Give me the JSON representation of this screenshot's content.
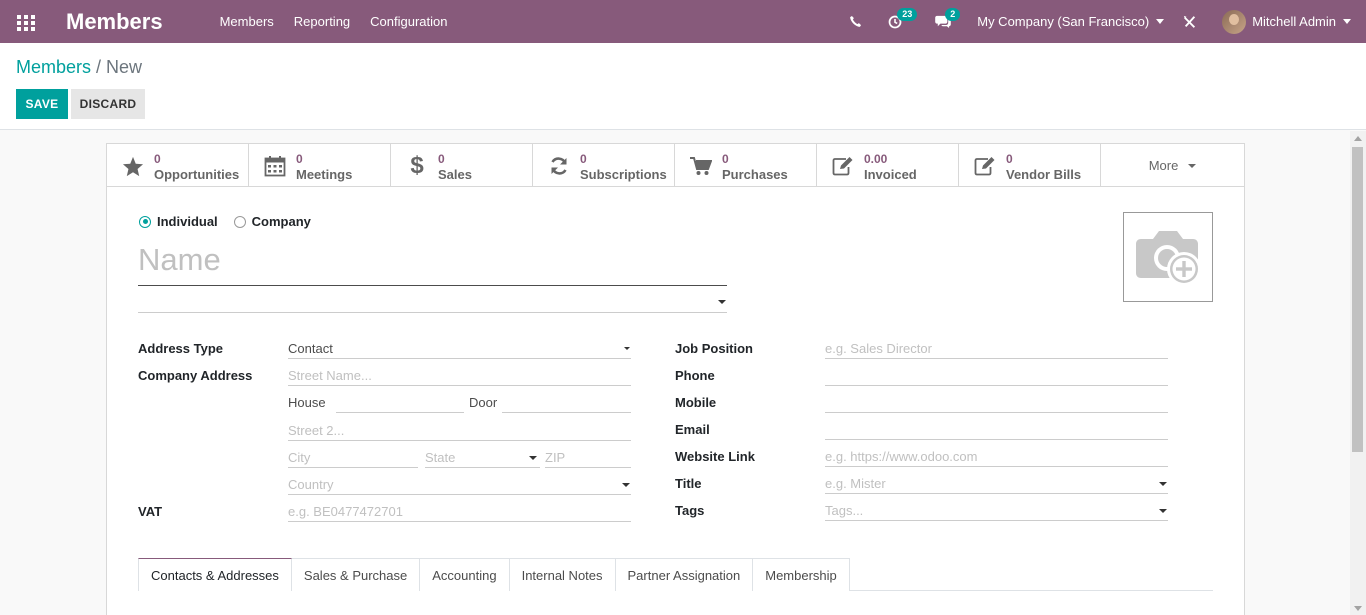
{
  "navbar": {
    "brand": "Members",
    "menu": [
      "Members",
      "Reporting",
      "Configuration"
    ],
    "activity_count": "23",
    "message_count": "2",
    "company": "My Company (San Francisco)",
    "user": "Mitchell Admin"
  },
  "breadcrumb": {
    "parent": "Members",
    "separator": "/",
    "current": "New"
  },
  "buttons": {
    "save": "SAVE",
    "discard": "DISCARD"
  },
  "stat_buttons": [
    {
      "value": "0",
      "label": "Opportunities",
      "icon": "star-icon"
    },
    {
      "value": "0",
      "label": "Meetings",
      "icon": "calendar-icon"
    },
    {
      "value": "0",
      "label": "Sales",
      "icon": "dollar-icon"
    },
    {
      "value": "0",
      "label": "Subscriptions",
      "icon": "refresh-icon"
    },
    {
      "value": "0",
      "label": "Purchases",
      "icon": "cart-icon"
    },
    {
      "value": "0.00",
      "label": "Invoiced",
      "icon": "edit-icon"
    },
    {
      "value": "0",
      "label": "Vendor Bills",
      "icon": "edit-icon"
    }
  ],
  "more_label": "More",
  "company_type": {
    "individual": "Individual",
    "company": "Company",
    "selected": "Individual"
  },
  "name_placeholder": "Name",
  "left_fields": {
    "address_type_label": "Address Type",
    "address_type_value": "Contact",
    "company_address_label": "Company Address",
    "street_placeholder": "Street Name...",
    "house_label": "House",
    "door_label": "Door",
    "street2_placeholder": "Street 2...",
    "city_placeholder": "City",
    "state_placeholder": "State",
    "zip_placeholder": "ZIP",
    "country_placeholder": "Country",
    "vat_label": "VAT",
    "vat_placeholder": "e.g. BE0477472701"
  },
  "right_fields": {
    "job_position_label": "Job Position",
    "job_position_placeholder": "e.g. Sales Director",
    "phone_label": "Phone",
    "mobile_label": "Mobile",
    "email_label": "Email",
    "website_label": "Website Link",
    "website_placeholder": "e.g. https://www.odoo.com",
    "title_label": "Title",
    "title_placeholder": "e.g. Mister",
    "tags_label": "Tags",
    "tags_placeholder": "Tags..."
  },
  "tabs": [
    "Contacts & Addresses",
    "Sales & Purchase",
    "Accounting",
    "Internal Notes",
    "Partner Assignation",
    "Membership"
  ],
  "active_tab": "Contacts & Addresses",
  "colors": {
    "brand": "#875a7b",
    "accent": "#00a09d"
  }
}
